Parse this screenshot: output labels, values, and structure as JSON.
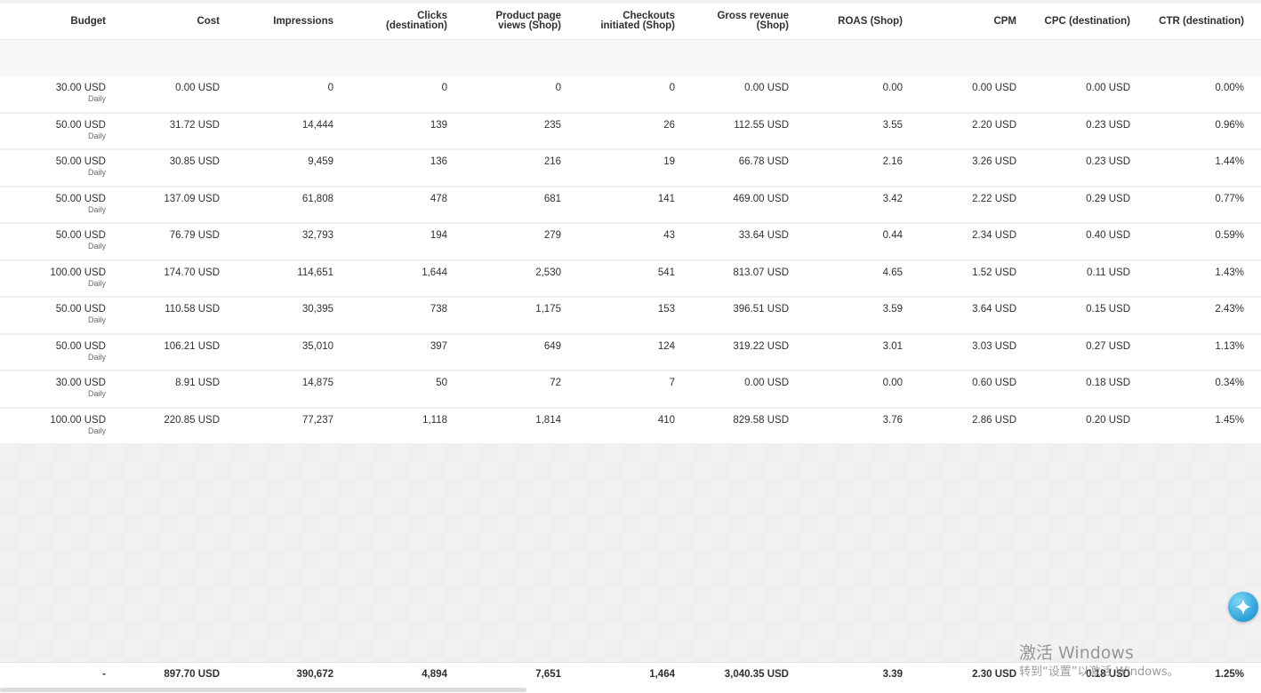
{
  "columns": [
    {
      "key": "budget",
      "label_lines": [
        "Budget"
      ]
    },
    {
      "key": "cost",
      "label_lines": [
        "Cost"
      ]
    },
    {
      "key": "impressions",
      "label_lines": [
        "Impressions"
      ]
    },
    {
      "key": "clicks",
      "label_lines": [
        "Clicks",
        "(destination)"
      ]
    },
    {
      "key": "ppv",
      "label_lines": [
        "Product page",
        "views (Shop)"
      ]
    },
    {
      "key": "checkouts",
      "label_lines": [
        "Checkouts",
        "initiated (Shop)"
      ]
    },
    {
      "key": "revenue",
      "label_lines": [
        "Gross revenue",
        "(Shop)"
      ]
    },
    {
      "key": "roas",
      "label_lines": [
        "ROAS (Shop)"
      ]
    },
    {
      "key": "cpm",
      "label_lines": [
        "CPM"
      ]
    },
    {
      "key": "cpc",
      "label_lines": [
        "CPC (destination)"
      ]
    },
    {
      "key": "ctr",
      "label_lines": [
        "CTR (destination)"
      ]
    }
  ],
  "rows": [
    {
      "budget": "30.00 USD",
      "budget_period": "Daily",
      "cost": "0.00 USD",
      "impressions": "0",
      "clicks": "0",
      "ppv": "0",
      "checkouts": "0",
      "revenue": "0.00 USD",
      "roas": "0.00",
      "cpm": "0.00 USD",
      "cpc": "0.00 USD",
      "ctr": "0.00%"
    },
    {
      "budget": "50.00 USD",
      "budget_period": "Daily",
      "cost": "31.72 USD",
      "impressions": "14,444",
      "clicks": "139",
      "ppv": "235",
      "checkouts": "26",
      "revenue": "112.55 USD",
      "roas": "3.55",
      "cpm": "2.20 USD",
      "cpc": "0.23 USD",
      "ctr": "0.96%"
    },
    {
      "budget": "50.00 USD",
      "budget_period": "Daily",
      "cost": "30.85 USD",
      "impressions": "9,459",
      "clicks": "136",
      "ppv": "216",
      "checkouts": "19",
      "revenue": "66.78 USD",
      "roas": "2.16",
      "cpm": "3.26 USD",
      "cpc": "0.23 USD",
      "ctr": "1.44%"
    },
    {
      "budget": "50.00 USD",
      "budget_period": "Daily",
      "cost": "137.09 USD",
      "impressions": "61,808",
      "clicks": "478",
      "ppv": "681",
      "checkouts": "141",
      "revenue": "469.00 USD",
      "roas": "3.42",
      "cpm": "2.22 USD",
      "cpc": "0.29 USD",
      "ctr": "0.77%"
    },
    {
      "budget": "50.00 USD",
      "budget_period": "Daily",
      "cost": "76.79 USD",
      "impressions": "32,793",
      "clicks": "194",
      "ppv": "279",
      "checkouts": "43",
      "revenue": "33.64 USD",
      "roas": "0.44",
      "cpm": "2.34 USD",
      "cpc": "0.40 USD",
      "ctr": "0.59%"
    },
    {
      "budget": "100.00 USD",
      "budget_period": "Daily",
      "cost": "174.70 USD",
      "impressions": "114,651",
      "clicks": "1,644",
      "ppv": "2,530",
      "checkouts": "541",
      "revenue": "813.07 USD",
      "roas": "4.65",
      "cpm": "1.52 USD",
      "cpc": "0.11 USD",
      "ctr": "1.43%"
    },
    {
      "budget": "50.00 USD",
      "budget_period": "Daily",
      "cost": "110.58 USD",
      "impressions": "30,395",
      "clicks": "738",
      "ppv": "1,175",
      "checkouts": "153",
      "revenue": "396.51 USD",
      "roas": "3.59",
      "cpm": "3.64 USD",
      "cpc": "0.15 USD",
      "ctr": "2.43%"
    },
    {
      "budget": "50.00 USD",
      "budget_period": "Daily",
      "cost": "106.21 USD",
      "impressions": "35,010",
      "clicks": "397",
      "ppv": "649",
      "checkouts": "124",
      "revenue": "319.22 USD",
      "roas": "3.01",
      "cpm": "3.03 USD",
      "cpc": "0.27 USD",
      "ctr": "1.13%"
    },
    {
      "budget": "30.00 USD",
      "budget_period": "Daily",
      "cost": "8.91 USD",
      "impressions": "14,875",
      "clicks": "50",
      "ppv": "72",
      "checkouts": "7",
      "revenue": "0.00 USD",
      "roas": "0.00",
      "cpm": "0.60 USD",
      "cpc": "0.18 USD",
      "ctr": "0.34%"
    },
    {
      "budget": "100.00 USD",
      "budget_period": "Daily",
      "cost": "220.85 USD",
      "impressions": "77,237",
      "clicks": "1,118",
      "ppv": "1,814",
      "checkouts": "410",
      "revenue": "829.58 USD",
      "roas": "3.76",
      "cpm": "2.86 USD",
      "cpc": "0.20 USD",
      "ctr": "1.45%"
    }
  ],
  "totals": {
    "budget": "-",
    "cost": "897.70 USD",
    "impressions": "390,672",
    "clicks": "4,894",
    "ppv": "7,651",
    "checkouts": "1,464",
    "revenue": "3,040.35 USD",
    "roas": "3.39",
    "cpm": "2.30 USD",
    "cpc": "0.18 USD",
    "ctr": "1.25%"
  },
  "floating_button": {
    "icon": "sparkle-icon",
    "color": "#2a9fd8"
  },
  "watermark": {
    "title": "激活 Windows",
    "subtitle": "转到“设置”以激活 Windows。"
  },
  "colors": {
    "row_bg": "#ffffff",
    "divider": "#efefef",
    "empty_bg": "#f2f2f2",
    "text": "#303030"
  }
}
